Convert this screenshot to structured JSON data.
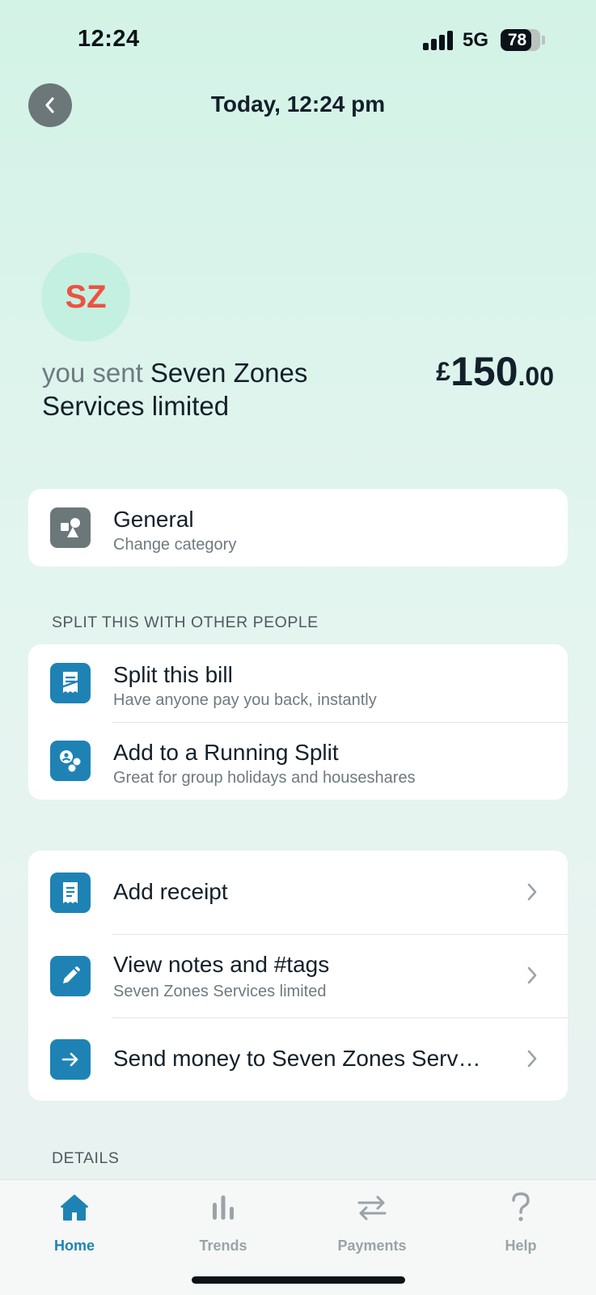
{
  "status_bar": {
    "time": "12:24",
    "network": "5G",
    "battery": "78",
    "battery_level": 0.78
  },
  "header": {
    "title": "Today, 12:24 pm",
    "back_icon": "chevron-left-icon"
  },
  "transaction": {
    "avatar_initials": "SZ",
    "prefix": "you sent",
    "merchant": "Seven Zones Services limited",
    "currency_symbol": "£",
    "amount_whole": "150",
    "amount_decimal": ".00"
  },
  "category": {
    "title": "General",
    "subtitle": "Change category",
    "icon": "category-shapes-icon"
  },
  "split_section": {
    "label": "SPLIT THIS WITH OTHER PEOPLE",
    "items": [
      {
        "title": "Split this bill",
        "subtitle": "Have anyone pay you back, instantly",
        "icon": "split-bill-icon"
      },
      {
        "title": "Add to a Running Split",
        "subtitle": "Great for group holidays and houseshares",
        "icon": "running-split-icon"
      }
    ]
  },
  "actions": {
    "items": [
      {
        "title": "Add receipt",
        "subtitle": "",
        "icon": "receipt-icon"
      },
      {
        "title": "View notes and #tags",
        "subtitle": "Seven Zones Services limited",
        "icon": "pencil-icon"
      },
      {
        "title": "Send money to Seven Zones Serv…",
        "subtitle": "",
        "icon": "arrow-right-icon"
      }
    ]
  },
  "details_section": {
    "label": "DETAILS"
  },
  "tab_bar": {
    "tabs": [
      {
        "label": "Home",
        "icon": "home-icon",
        "active": true
      },
      {
        "label": "Trends",
        "icon": "trends-icon",
        "active": false
      },
      {
        "label": "Payments",
        "icon": "payments-icon",
        "active": false
      },
      {
        "label": "Help",
        "icon": "help-icon",
        "active": false
      }
    ]
  },
  "colors": {
    "accent": "#1e83b4",
    "initials": "#ef5140",
    "avatar_bg": "#c4f0e1",
    "icon_grey": "#6c7779"
  }
}
